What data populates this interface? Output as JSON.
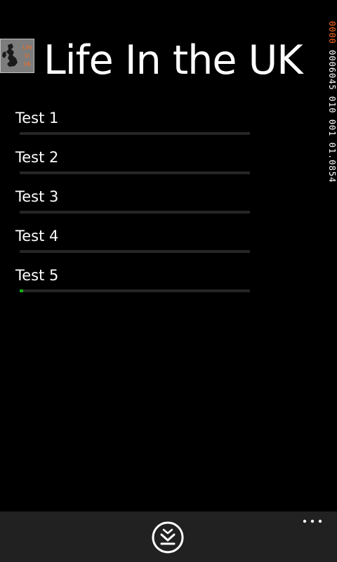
{
  "app": {
    "title": "Life In the UK",
    "icon_name": "uk-map-app-icon",
    "icon_text": "Life In UK"
  },
  "debug_counters": {
    "hot": "0000",
    "cold": "0006045 010 001 01.0854"
  },
  "tests": [
    {
      "label": "Test 1",
      "progress": 0
    },
    {
      "label": "Test 2",
      "progress": 0
    },
    {
      "label": "Test 3",
      "progress": 0
    },
    {
      "label": "Test 4",
      "progress": 0
    },
    {
      "label": "Test 5",
      "progress": 0.015
    }
  ],
  "app_bar": {
    "primary_icon": "download-chevron-icon",
    "more_icon": "ellipsis-icon"
  },
  "colors": {
    "background": "#000000",
    "progress_fill": "#15b015",
    "progress_track": "#262626",
    "counter_hot": "#ff6a1a",
    "app_bar": "#212121"
  }
}
